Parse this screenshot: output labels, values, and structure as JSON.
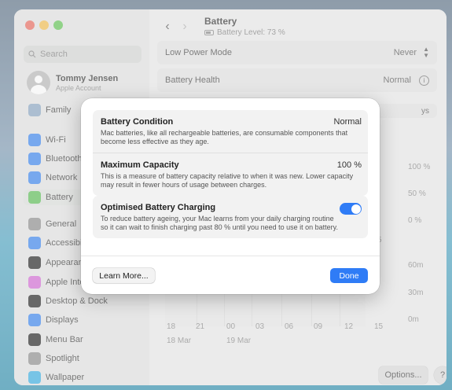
{
  "window": {
    "traffic_lights": [
      "close",
      "minimize",
      "zoom"
    ]
  },
  "sidebar": {
    "search_placeholder": "Search",
    "account": {
      "name": "Tommy Jensen",
      "subtitle": "Apple Account"
    },
    "items": [
      {
        "label": "Family",
        "icon": "family-icon",
        "color": "#8aa6c4"
      },
      {
        "label": "Wi-Fi",
        "icon": "wifi-icon",
        "color": "#3a84f0"
      },
      {
        "label": "Bluetooth",
        "icon": "bluetooth-icon",
        "color": "#3a84f0"
      },
      {
        "label": "Network",
        "icon": "network-icon",
        "color": "#3a84f0"
      },
      {
        "label": "Battery",
        "icon": "battery-icon",
        "color": "#5bbf55"
      },
      {
        "label": "General",
        "icon": "gear-icon",
        "color": "#8e8e8e"
      },
      {
        "label": "Accessibility",
        "icon": "accessibility-icon",
        "color": "#3a84f0"
      },
      {
        "label": "Appearance",
        "icon": "appearance-icon",
        "color": "#222222"
      },
      {
        "label": "Apple Intelligence & Siri",
        "icon": "siri-icon",
        "color": "#d46bd6"
      },
      {
        "label": "Desktop & Dock",
        "icon": "dock-icon",
        "color": "#222222"
      },
      {
        "label": "Displays",
        "icon": "display-icon",
        "color": "#3a84f0"
      },
      {
        "label": "Menu Bar",
        "icon": "menubar-icon",
        "color": "#222222"
      },
      {
        "label": "Spotlight",
        "icon": "spotlight-icon",
        "color": "#8e8e8e"
      },
      {
        "label": "Wallpaper",
        "icon": "wallpaper-icon",
        "color": "#39b0e4"
      }
    ]
  },
  "main": {
    "title": "Battery",
    "subtitle": "Battery Level: 73 %",
    "low_power_label": "Low Power Mode",
    "low_power_value": "Never",
    "battery_health_label": "Battery Health",
    "battery_health_value": "Normal",
    "right_axis_pct": [
      "100 %",
      "50 %",
      "0 %"
    ],
    "right_axis_time": [
      "60m",
      "30m",
      "0m"
    ],
    "x_ticks": [
      "18",
      "21",
      "00",
      "03",
      "06",
      "09",
      "12",
      "15"
    ],
    "date_labels": [
      "18 Mar",
      "19 Mar"
    ],
    "partial_labels": [
      "ys",
      "5"
    ],
    "options_button": "Options...",
    "help_button": "?"
  },
  "sheet": {
    "condition": {
      "title": "Battery Condition",
      "value": "Normal",
      "description": "Mac batteries, like all rechargeable batteries, are consumable components that become less effective as they age."
    },
    "capacity": {
      "title": "Maximum Capacity",
      "value": "100 %",
      "description": "This is a measure of battery capacity relative to when it was new. Lower capacity may result in fewer hours of usage between charges."
    },
    "optimised": {
      "title": "Optimised Battery Charging",
      "enabled": true,
      "description": "To reduce battery ageing, your Mac learns from your daily charging routine so it can wait to finish charging past 80 % until you need to use it on battery."
    },
    "learn_more_button": "Learn More...",
    "done_button": "Done"
  }
}
